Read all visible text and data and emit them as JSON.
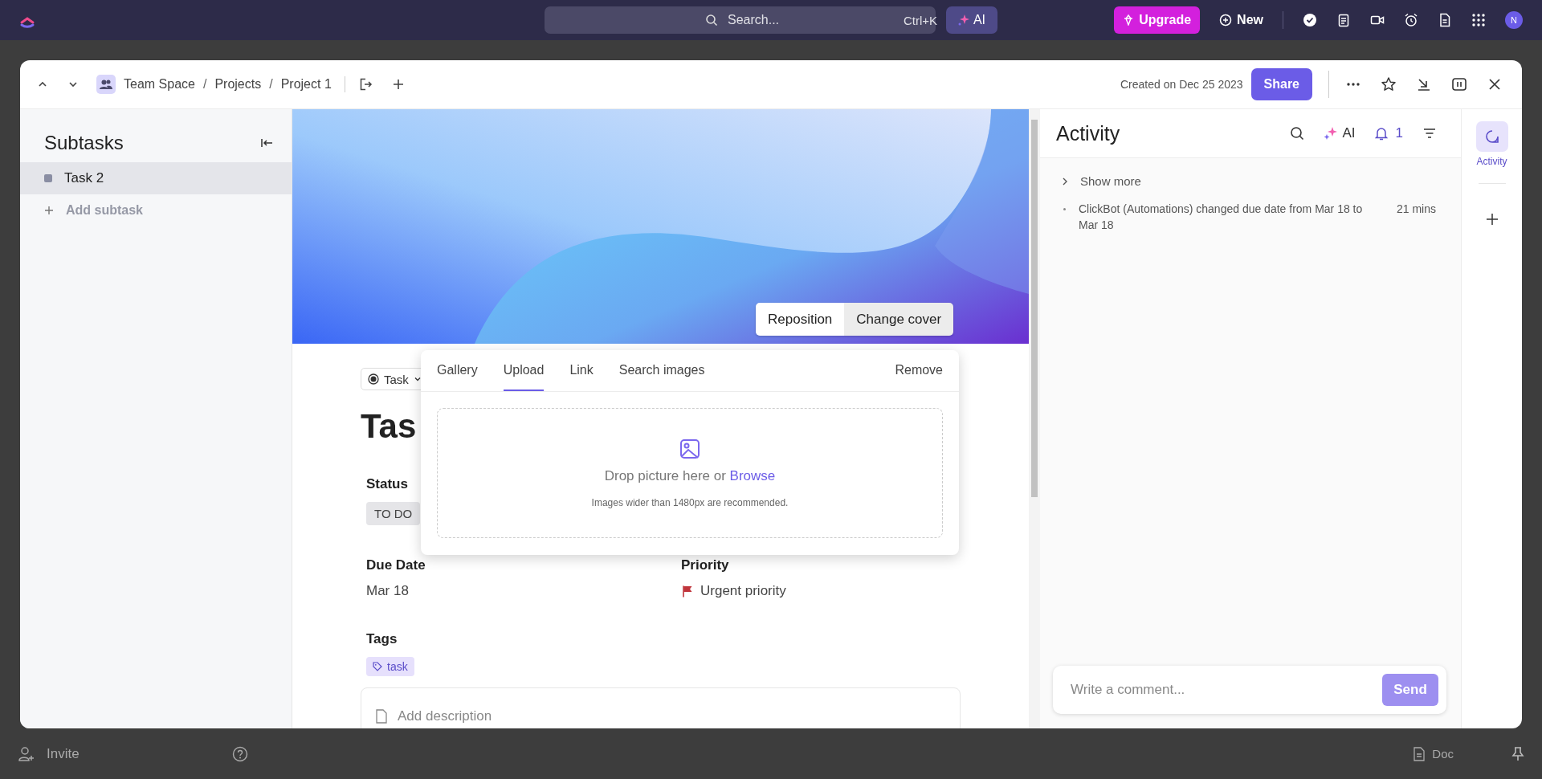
{
  "topbar": {
    "search": {
      "placeholder": "Search...",
      "shortcut": "Ctrl+K"
    },
    "ai_button": "AI",
    "upgrade_button": "Upgrade",
    "new_button": "New",
    "avatar": "N"
  },
  "task_modal": {
    "breadcrumb": [
      "Team Space",
      "Projects",
      "Project 1"
    ],
    "breadcrumb_separator": "/",
    "created": "Created on Dec 25 2023",
    "share_button": "Share"
  },
  "subtasks": {
    "title": "Subtasks",
    "items": [
      {
        "name": "Task 2",
        "selected": true
      }
    ],
    "add_label": "Add subtask"
  },
  "cover": {
    "kind": "picture",
    "buttons": [
      "Reposition",
      "Change cover"
    ]
  },
  "task": {
    "type": "Task",
    "title": "Tas",
    "fields": [
      {
        "label": "Status",
        "value": "TO DO",
        "kind": "status"
      },
      {
        "label": "Due Date",
        "value": "Mar 18",
        "kind": "text"
      },
      {
        "label": "Priority",
        "value": "Urgent priority",
        "kind": "priority"
      },
      {
        "label": "Tags",
        "value": "task",
        "kind": "tag"
      }
    ],
    "description_placeholder": "Add description"
  },
  "cover_popup": {
    "tabs": [
      {
        "label": "Gallery",
        "selected": false
      },
      {
        "label": "Upload",
        "selected": true
      },
      {
        "label": "Link",
        "selected": false
      },
      {
        "label": "Search images",
        "selected": false
      }
    ],
    "remove": "Remove",
    "drop_text": "Drop picture here or",
    "browse_link": "Browse",
    "hint": "Images wider than 1480px are recommended."
  },
  "activity": {
    "title": "Activity",
    "ai_label": "AI",
    "notification_count": "1",
    "show_more": "Show more",
    "events": [
      {
        "text": "ClickBot (Automations) changed due date from Mar 18 to Mar 18",
        "time": "21 mins"
      }
    ],
    "comment": {
      "placeholder": "Write a comment...",
      "send_button": "Send"
    }
  },
  "rail": {
    "items": [
      {
        "label": "Activity",
        "selected": true
      }
    ]
  },
  "bottom_bar": {
    "invite": "Invite",
    "doc": "Doc"
  }
}
